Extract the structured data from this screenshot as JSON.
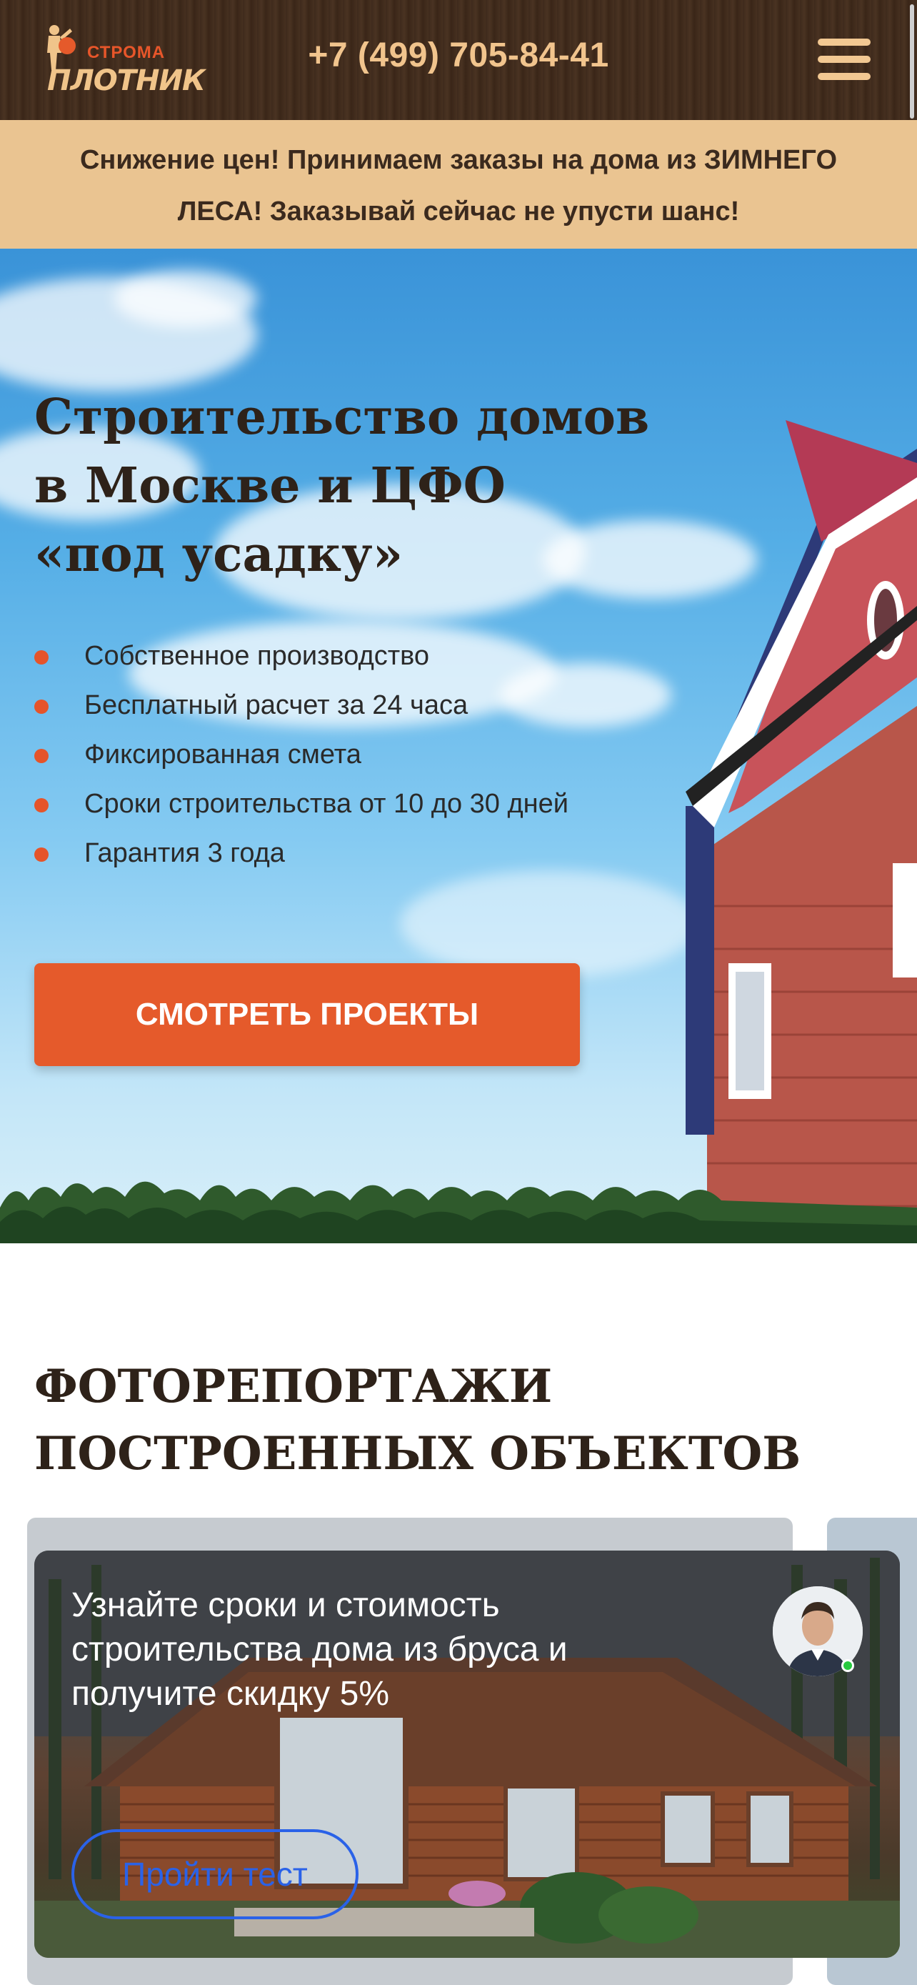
{
  "header": {
    "logo_small": "СТРОМА",
    "logo_main": "ПЛОТНИК",
    "phone": "+7 (499) 705-84-41",
    "menu_icon": "hamburger-menu-icon"
  },
  "promo": {
    "line1": "Снижение цен! Принимаем заказы на дома из ЗИМНЕГО",
    "line2": "ЛЕСА! Заказывай сейчас не упусти шанс!"
  },
  "hero": {
    "title_lines": [
      "Строительство домов",
      "в Москве и ЦФО",
      "«под усадку»"
    ],
    "features": [
      "Собственное производство",
      "Бесплатный расчет за 24 часа",
      "Фиксированная смета",
      "Сроки строительства от 10 до 30 дней",
      "Гарантия 3 года"
    ],
    "cta_label": "СМОТРЕТЬ ПРОЕКТЫ"
  },
  "photo_section": {
    "title_lines": [
      "ФОТОРЕПОРТАЖИ",
      "ПОСТРОЕННЫХ ОБЪЕКТОВ"
    ]
  },
  "popup": {
    "text_lines": [
      "Узнайте сроки и стоимость",
      "строительства дома из бруса и",
      "получите скидку 5%"
    ],
    "button_label": "Пройти тест"
  },
  "colors": {
    "accent": "#e55a2b",
    "header_bg": "#3e2a1c",
    "promo_bg": "#eac491",
    "gold_text": "#f1c48d",
    "title_text": "#2e2219",
    "link_blue": "#2a62e8"
  }
}
